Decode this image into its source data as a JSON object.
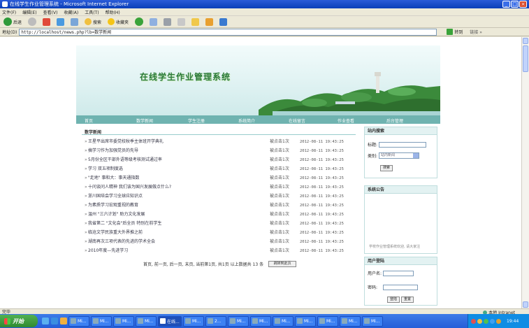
{
  "window": {
    "title": "在线学生作业管理系统 - Microsoft Internet Explorer",
    "minimize": "_",
    "maximize": "□",
    "close": "×"
  },
  "menubar": [
    "文件(F)",
    "编辑(E)",
    "查看(V)",
    "收藏(A)",
    "工具(T)",
    "帮助(H)"
  ],
  "toolbar": {
    "back": "后退",
    "search": "搜索",
    "favorites": "收藏夹"
  },
  "address": {
    "label": "地址(D)",
    "url": "http://localhost/news.php?lb=数学新闻",
    "go": "转到",
    "links": "链接 »"
  },
  "site": {
    "title": "在线学生作业管理系统",
    "nav": [
      "首页",
      "数学新闻",
      "学生注册",
      "系统简介",
      "在线留言",
      "作业查看",
      "后台管理"
    ]
  },
  "news": {
    "section_title": "数学新闻",
    "by_label": "被点击1次",
    "items": [
      {
        "title": "王星平出席市委党校秋季主体班开学典礼",
        "date": "2012-08-11 19:43:25"
      },
      {
        "title": "搞学习作为加强党员的先导",
        "date": "2012-08-11 19:43:25"
      },
      {
        "title": "5月份全区干部外语等级考核测试通过率",
        "date": "2012-08-11 19:43:25"
      },
      {
        "title": "学习 双五项制度选",
        "date": "2012-08-11 19:43:25"
      },
      {
        "title": "\"走地\" 事和大：事天通指数",
        "date": "2012-08-11 19:43:25"
      },
      {
        "title": "十问谈问人精神 我们该为国兴发展做点什么?",
        "date": "2012-08-11 19:43:25"
      },
      {
        "title": "浙川国培会学习全球应知识点",
        "date": "2012-08-11 19:43:25"
      },
      {
        "title": "为素质学习宏观重视的教育",
        "date": "2012-08-11 19:43:25"
      },
      {
        "title": "温州 \"三六计划\" 助力文化发展",
        "date": "2012-08-11 19:43:25"
      },
      {
        "title": "我省第二 \"文化会\"后全员 特别在前学生",
        "date": "2012-08-11 19:43:25"
      },
      {
        "title": "临沧文学民族重大外界推之前",
        "date": "2012-08-11 19:43:25"
      },
      {
        "title": "湖南再次三项代表的先进的学术全会",
        "date": "2012-08-11 19:43:25"
      },
      {
        "title": "2010年度—先进学习",
        "date": "2012-08-11 19:43:25"
      }
    ],
    "pager": "首页, 前一页, 后一页, 末页, 当前第1页, 共1页 以上数据共 13 条",
    "jump": "跳转到此页"
  },
  "sidebar": {
    "search_title": "站内搜索",
    "keyword_label": "标题:",
    "type_label": "类别:",
    "type_value": "站内新闻",
    "search_btn": "搜索",
    "notice_title": "系统公告",
    "notice_text": "学校作业管理系统欢迎, 请大家注",
    "login_title": "用户登陆",
    "username_label": "用户名:",
    "password_label": "密码:",
    "login_btn": "登陆",
    "reset_btn": "重置"
  },
  "status": {
    "left": "完毕",
    "zone": "本地 Intranet"
  },
  "taskbar": {
    "start": "开始",
    "tasks": [
      "Mi...",
      "Mi...",
      "Mi...",
      "Mi...",
      "在线...",
      "Mi...",
      "2...",
      "Mi...",
      "Mi...",
      "Mi...",
      "Mi...",
      "Mi...",
      "Mi...",
      "Mi..."
    ],
    "clock": "19:44"
  },
  "colors": {
    "nav": "#6fb3b0",
    "title_bar": "#0a3fb8",
    "taskbar": "#245ed8",
    "banner_title": "#2a7a3a"
  }
}
